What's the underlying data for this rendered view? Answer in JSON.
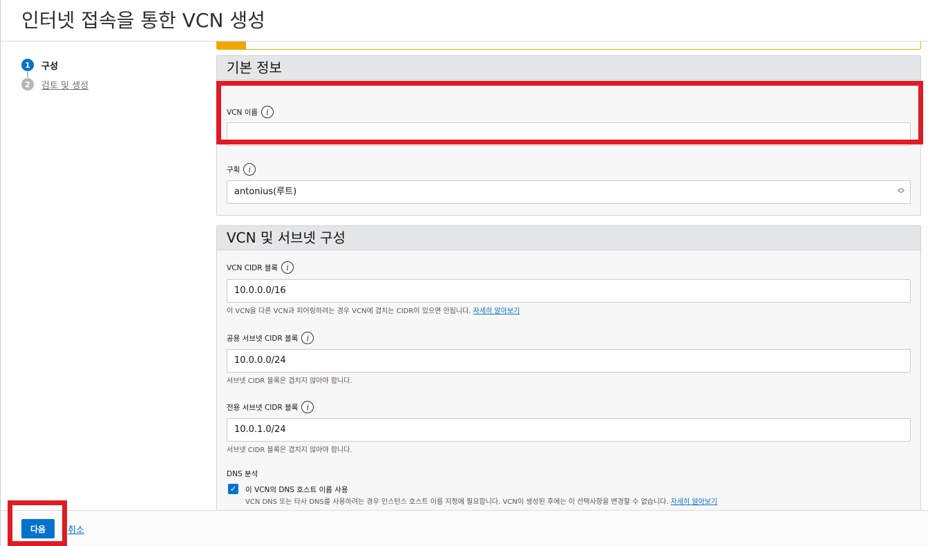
{
  "header": {
    "title": "인터넷 접속을 통한 VCN 생성"
  },
  "steps": [
    {
      "number": "1",
      "label": "구성"
    },
    {
      "number": "2",
      "label": "검토 및 생성"
    }
  ],
  "basic_info": {
    "heading": "기본 정보",
    "vcn_name": {
      "label": "VCN 이름",
      "value": ""
    },
    "compartment": {
      "label": "구획",
      "value": "antonius(루트)"
    }
  },
  "vcn_subnet": {
    "heading": "VCN 및 서브넷 구성",
    "vcn_cidr": {
      "label": "VCN CIDR 블록",
      "value": "10.0.0.0/16",
      "help": "이 VCN을 다른 VCN과 피어링하려는 경우 VCN에 겹치는 CIDR이 있으면 안됩니다.",
      "help_link": "자세히 알아보기"
    },
    "public_cidr": {
      "label": "공용 서브넷 CIDR 블록",
      "value": "10.0.0.0/24",
      "help": "서브넷 CIDR 블록은 겹치지 않아야 합니다."
    },
    "private_cidr": {
      "label": "전용 서브넷 CIDR 블록",
      "value": "10.0.1.0/24",
      "help": "서브넷 CIDR 블록은 겹치지 않아야 합니다."
    },
    "dns": {
      "label": "DNS 분석",
      "checkbox_label": "이 VCN의 DNS 호스트 이름 사용",
      "checked": true,
      "help": "VCN DNS 또는 타사 DNS를 사용하려는 경우 인스턴스 호스트 이름 지정에 필요합니다. VCN이 생성된 후에는 이 선택사항을 변경할 수 없습니다.",
      "help_link": "자세히 알아보기"
    }
  },
  "footer": {
    "next_label": "다음",
    "cancel_label": "취소"
  },
  "colors": {
    "primary": "#0572ce",
    "highlight": "#e01b24",
    "warning": "#f0a800"
  }
}
